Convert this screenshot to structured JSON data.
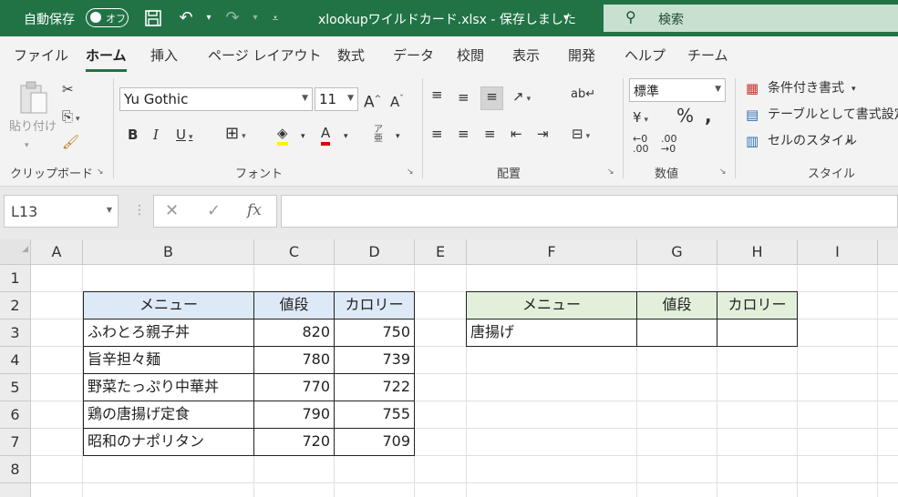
{
  "titlebar": {
    "autosave_label": "自動保存",
    "autosave_state": "オフ",
    "filename": "xlookupワイルドカード.xlsx  -  保存しました",
    "search_placeholder": "検索"
  },
  "tabs": [
    "ファイル",
    "ホーム",
    "挿入",
    "ページ レイアウト",
    "数式",
    "データ",
    "校閲",
    "表示",
    "開発",
    "ヘルプ",
    "チーム"
  ],
  "active_tab": "ホーム",
  "ribbon": {
    "clipboard": {
      "paste_label": "貼り付け",
      "group_label": "クリップボード"
    },
    "font": {
      "font_name": "Yu Gothic",
      "font_size": "11",
      "group_label": "フォント"
    },
    "alignment": {
      "group_label": "配置"
    },
    "number": {
      "format": "標準",
      "group_label": "数値"
    },
    "styles": {
      "conditional_format": "条件付き書式",
      "format_as_table": "テーブルとして書式設定",
      "cell_styles": "セルのスタイル",
      "group_label": "スタイル"
    }
  },
  "formula_bar": {
    "name_box": "L13",
    "formula": ""
  },
  "sheet": {
    "columns": [
      "A",
      "B",
      "C",
      "D",
      "E",
      "F",
      "G",
      "H",
      "I"
    ],
    "rows": [
      "1",
      "2",
      "3",
      "4",
      "5",
      "6",
      "7",
      "8"
    ],
    "table1": {
      "headers": [
        "メニュー",
        "値段",
        "カロリー"
      ],
      "rows": [
        [
          "ふわとろ親子丼",
          "820",
          "750"
        ],
        [
          "旨辛担々麺",
          "780",
          "739"
        ],
        [
          "野菜たっぷり中華丼",
          "770",
          "722"
        ],
        [
          "鶏の唐揚げ定食",
          "790",
          "755"
        ],
        [
          "昭和のナポリタン",
          "720",
          "709"
        ]
      ]
    },
    "table2": {
      "headers": [
        "メニュー",
        "値段",
        "カロリー"
      ],
      "row": [
        "唐揚げ",
        "",
        ""
      ]
    }
  },
  "colors": {
    "brand": "#217346",
    "table1_header": "#dde9f6",
    "table2_header": "#e2efda"
  }
}
